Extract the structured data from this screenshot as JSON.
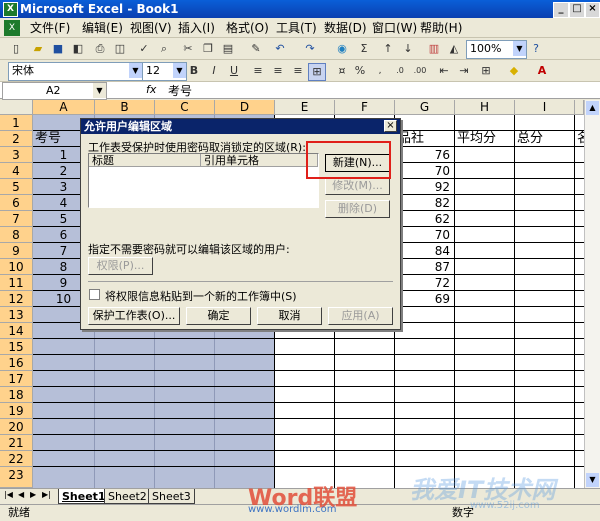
{
  "window": {
    "title": "Microsoft Excel - Book1",
    "app_icon": "X"
  },
  "menu": [
    "文件(F)",
    "编辑(E)",
    "视图(V)",
    "插入(I)",
    "格式(O)",
    "工具(T)",
    "数据(D)",
    "窗口(W)",
    "帮助(H)"
  ],
  "toolbar": {
    "zoom": "100%"
  },
  "format": {
    "font": "宋体",
    "size": "12",
    "bold": "B",
    "italic": "I",
    "underline": "U",
    "percent": "%"
  },
  "formula": {
    "name_box": "A2",
    "fx": "fx",
    "content": "考号"
  },
  "columns": [
    "A",
    "B",
    "C",
    "D",
    "E",
    "F",
    "G",
    "H",
    "I"
  ],
  "rows": [
    "1",
    "2",
    "3",
    "4",
    "5",
    "6",
    "7",
    "8",
    "9",
    "10",
    "11",
    "12",
    "13",
    "14",
    "15",
    "16",
    "17",
    "18",
    "19",
    "20",
    "21",
    "22",
    "23"
  ],
  "sheet": {
    "header": {
      "a": "考号",
      "g": "品社",
      "h": "平均分",
      "i": "总分",
      "j": "名"
    },
    "ids": [
      "1",
      "2",
      "3",
      "4",
      "5",
      "6",
      "7",
      "8",
      "9",
      "10"
    ],
    "g_values": [
      "76",
      "70",
      "92",
      "82",
      "62",
      "70",
      "84",
      "87",
      "72",
      "69"
    ]
  },
  "dialog": {
    "title": "允许用户编辑区域",
    "desc": "工作表受保护时使用密码取消锁定的区域(R):",
    "col_title": "标题",
    "col_ref": "引用单元格",
    "new_btn": "新建(N)...",
    "modify_btn": "修改(M)...",
    "delete_btn": "删除(D)",
    "users_label": "指定不需要密码就可以编辑该区域的用户:",
    "perm_btn": "权限(P)...",
    "checkbox": "将权限信息粘贴到一个新的工作簿中(S)",
    "protect_btn": "保护工作表(O)...",
    "ok_btn": "确定",
    "cancel_btn": "取消",
    "apply_btn": "应用(A)"
  },
  "tabs": [
    "Sheet1",
    "Sheet2",
    "Sheet3"
  ],
  "status": {
    "ready": "就绪",
    "num": "数字"
  },
  "watermarks": {
    "brand": "Word联盟",
    "brand_url": "www.wordlm.com",
    "brand2": "我爱IT技术网",
    "brand2_url": "www.52ij.com"
  }
}
